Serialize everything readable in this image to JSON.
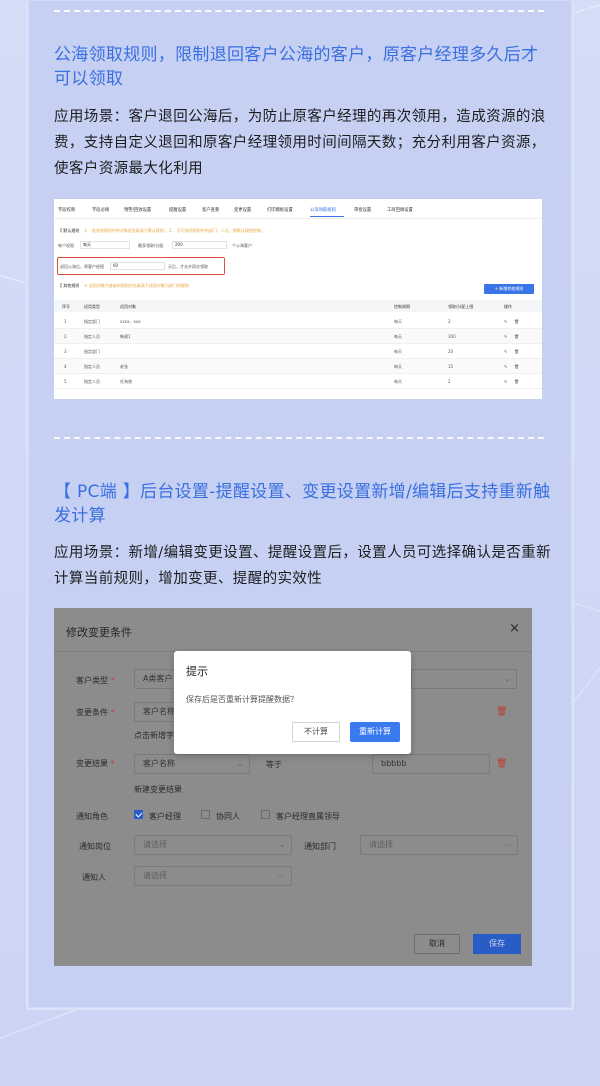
{
  "section1": {
    "title": "公海领取规则，限制退回客户公海的客户，原客户经理多久后才可以领取",
    "desc": "应用场景：客户退回公海后，为防止原客户经理的再次领用，造成资源的浪费，支持自定义退回和原客户经理领用时间间隔天数；充分利用客户资源，使客户资源最大化利用"
  },
  "shot1": {
    "tabs": [
      "字段权限",
      "字段必填",
      "预警/回收设置",
      "提醒设置",
      "客户查重",
      "变更设置",
      "打印模板设置",
      "公海领取规则",
      "审批设置",
      "工商回填设置"
    ],
    "active_tab": "公海领取规则",
    "default_rule_title": "【 默认规则",
    "default_rule_hint": "1、 若其他规则中的对象优先级高于默认规则。 2、 不可其他规则中的部门、人员，都默认规则控制。",
    "row1_label": "每个权限",
    "row1_value": "每天",
    "row1_label2": "最多领取/分配",
    "row1_value2": "200",
    "row1_suffix": "个公海客户",
    "row2_label": "退回公海后，原客户经理",
    "row2_value": "60",
    "row2_suffix": "天后，才允许再次领取",
    "other_rule_title": "【 其他规则",
    "other_rule_hint": "① 适用对象为各级的规则优先级高于适用对象为部门的规则",
    "add_button": "+ 新增其他规则",
    "headers": [
      "序号",
      "适用类型",
      "适用对象",
      "控制周期",
      "领取/分配上限",
      "操作"
    ],
    "rows": [
      [
        "1",
        "指定部门",
        "xxxx、xxx",
        "每天",
        "2"
      ],
      [
        "2",
        "指定人员",
        "韩建1",
        "每天",
        "100"
      ],
      [
        "3",
        "指定部门",
        "",
        "每天",
        "20"
      ],
      [
        "4",
        "指定人员",
        "老张",
        "每天",
        "15"
      ],
      [
        "5",
        "指定人员",
        "任海艳",
        "每天",
        "2"
      ]
    ]
  },
  "section2": {
    "title": "【 PC端 】后台设置-提醒设置、变更设置新增/编辑后支持重新触发计算",
    "desc": "应用场景：新增/编辑变更设置、提醒设置后，设置人员可选择确认是否重新计算当前规则，增加变更、提醒的实效性"
  },
  "shot2": {
    "title": "修改变更条件",
    "close": "×",
    "customer_type_label": "客户类型",
    "customer_type_value": "A类客户",
    "change_cond_label": "变更条件",
    "change_cond_field": "客户名称",
    "add_cond_link": "点击新增字",
    "change_result_label": "变更结果",
    "change_result_field": "客户名称",
    "equals": "等于",
    "change_result_value": "bbbbb",
    "add_result_link": "新建变更结果",
    "notify_role_label": "通知角色",
    "roles": [
      {
        "label": "客户经理",
        "checked": true
      },
      {
        "label": "协同人",
        "checked": false
      },
      {
        "label": "客户经理直属领导",
        "checked": false
      }
    ],
    "notify_post_label": "通知岗位",
    "notify_post_placeholder": "请选择",
    "notify_dept_label": "通知部门",
    "notify_dept_placeholder": "请选择",
    "notify_person_label": "通知人",
    "notify_person_placeholder": "请选择",
    "cancel": "取消",
    "save": "保存",
    "required_mark": "*"
  },
  "dialog": {
    "title": "提示",
    "message": "保存后是否重新计算提醒数据？",
    "no_button": "不计算",
    "yes_button": "重新计算"
  },
  "colors": {
    "accent": "#3a6fe0",
    "background": "#c9d3f2",
    "highlight_border": "#d9533a"
  }
}
